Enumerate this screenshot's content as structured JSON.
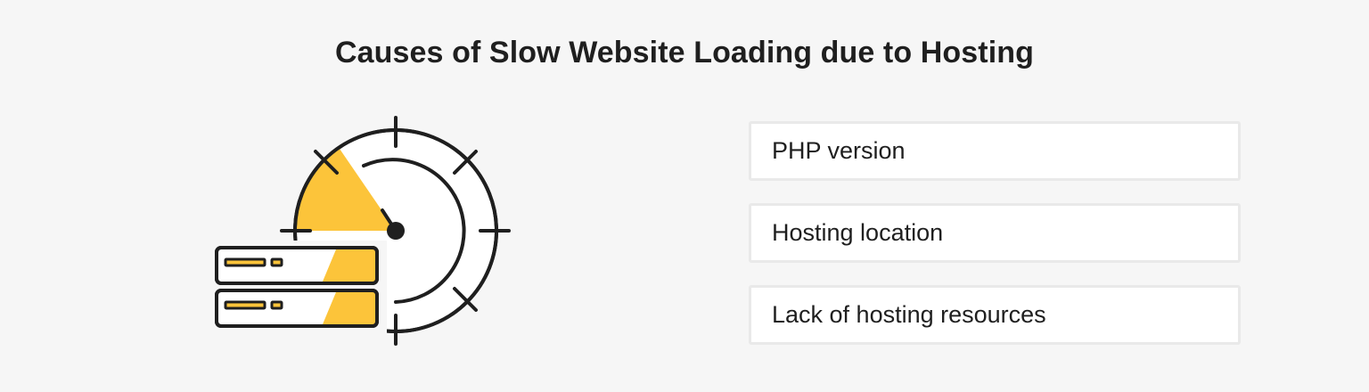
{
  "title": "Causes of Slow Website Loading due to Hosting",
  "causes": [
    {
      "label": "PHP version"
    },
    {
      "label": "Hosting location"
    },
    {
      "label": "Lack of hosting resources"
    }
  ],
  "illustration": {
    "icon": "server-speedometer-icon",
    "accent_color": "#fcc43a",
    "outline_color": "#1f1f1f"
  }
}
